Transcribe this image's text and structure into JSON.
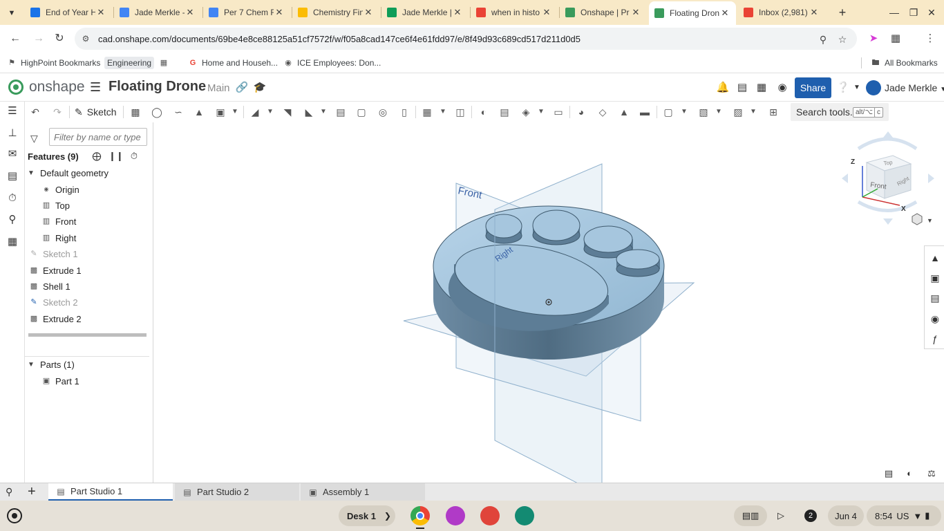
{
  "browser": {
    "tabs": [
      {
        "title": "End of Year H",
        "color": "#1a73e8",
        "glyph": "person-icon"
      },
      {
        "title": "Jade Merkle -",
        "color": "#4285f4",
        "glyph": "docs-icon"
      },
      {
        "title": "Per 7 Chem F",
        "color": "#4285f4",
        "glyph": "docs-icon"
      },
      {
        "title": "Chemistry Fin",
        "color": "#fbbc04",
        "glyph": "slides-icon"
      },
      {
        "title": "Jade Merkle |",
        "color": "#0f9d58",
        "glyph": "classroom-icon"
      },
      {
        "title": "when in histo",
        "color": "#ea4335",
        "glyph": "google-icon"
      },
      {
        "title": "Onshape | Pr",
        "color": "#3a9b5c",
        "glyph": "onshape-icon"
      },
      {
        "title": "Floating Dron",
        "color": "#3a9b5c",
        "glyph": "onshape-icon"
      },
      {
        "title": "Inbox (2,981)",
        "color": "#ea4335",
        "glyph": "gmail-icon"
      }
    ],
    "active_tab": 7,
    "url": "cad.onshape.com/documents/69be4e8ce88125a51cf7572f/w/f05a8cad147ce6f4e61fdd97/e/8f49d93c689cd517d211d0d5",
    "bookmarks": [
      {
        "label": "HighPoint Bookmarks",
        "icon": "bookmark-icon"
      },
      {
        "label": "Engineering",
        "icon": ""
      },
      {
        "label": "Home and Househ...",
        "icon": "google-icon"
      },
      {
        "label": "ICE Employees: Don...",
        "icon": "globe-icon"
      }
    ],
    "all_bookmarks": "All Bookmarks"
  },
  "onshape": {
    "brand": "onshape",
    "doc_title": "Floating Drone",
    "branch": "Main",
    "share_label": "Share",
    "user_name": "Jade Merkle",
    "sketch_label": "Sketch",
    "search_tools": "Search tools...",
    "search_kbd_1": "alt/⌥",
    "search_kbd_2": "c",
    "filter_placeholder": "Filter by name or type",
    "features_header": "Features (9)",
    "default_geometry": "Default geometry",
    "geometry_items": [
      "Origin",
      "Top",
      "Front",
      "Right"
    ],
    "features": [
      {
        "label": "Sketch 1",
        "dim": true
      },
      {
        "label": "Extrude 1",
        "dim": false
      },
      {
        "label": "Shell 1",
        "dim": false
      },
      {
        "label": "Sketch 2",
        "dim": true
      },
      {
        "label": "Extrude 2",
        "dim": false
      }
    ],
    "parts_header": "Parts (1)",
    "parts": [
      "Part 1"
    ],
    "viewport": {
      "front_label": "Front",
      "right_label": "Right",
      "cube_top": "Top",
      "cube_front": "Front",
      "cube_right": "Right",
      "axis_z": "Z",
      "axis_x": "X"
    },
    "doc_tabs": [
      {
        "label": "Part Studio 1",
        "active": true
      },
      {
        "label": "Part Studio 2",
        "active": false
      },
      {
        "label": "Assembly 1",
        "active": false
      }
    ]
  },
  "shelf": {
    "desk": "Desk 1",
    "notification_count": "2",
    "date": "Jun 4",
    "time": "8:54",
    "locale": "US"
  },
  "colors": {
    "brand_green": "#3a9b5c",
    "share_blue": "#1f5fae",
    "model_blue": "#9fc3dd",
    "model_side": "#5d7d96"
  }
}
